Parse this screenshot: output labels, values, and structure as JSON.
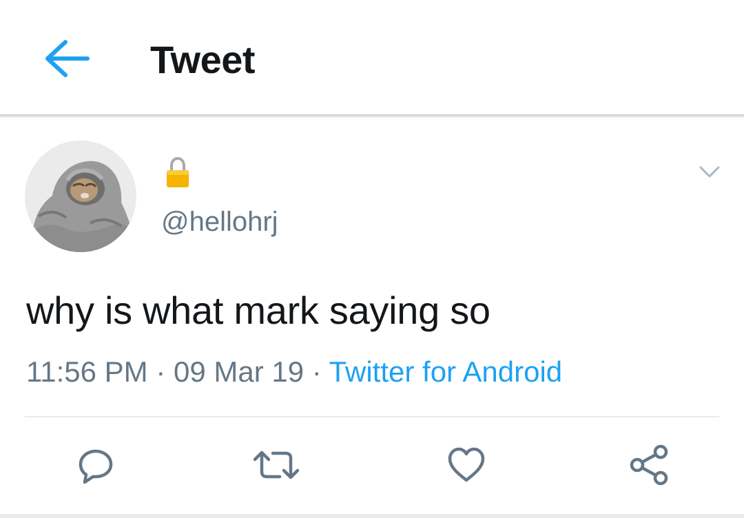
{
  "header": {
    "title": "Tweet",
    "back_icon": "arrow-left-icon"
  },
  "tweet": {
    "handle": "@hellohrj",
    "protected_icon": "lock-icon",
    "text": "why is what mark saying so",
    "time": "11:56 PM",
    "date": "09 Mar 19",
    "separator": "·",
    "source": "Twitter for Android"
  },
  "actions": [
    {
      "name": "reply",
      "icon": "reply-icon"
    },
    {
      "name": "retweet",
      "icon": "retweet-icon"
    },
    {
      "name": "like",
      "icon": "heart-icon"
    },
    {
      "name": "share",
      "icon": "share-icon"
    }
  ],
  "colors": {
    "accent": "#1da1f2",
    "text": "#14171a",
    "secondary_text": "#657786",
    "divider": "#e6ecf0",
    "lock": "#f5b400"
  }
}
